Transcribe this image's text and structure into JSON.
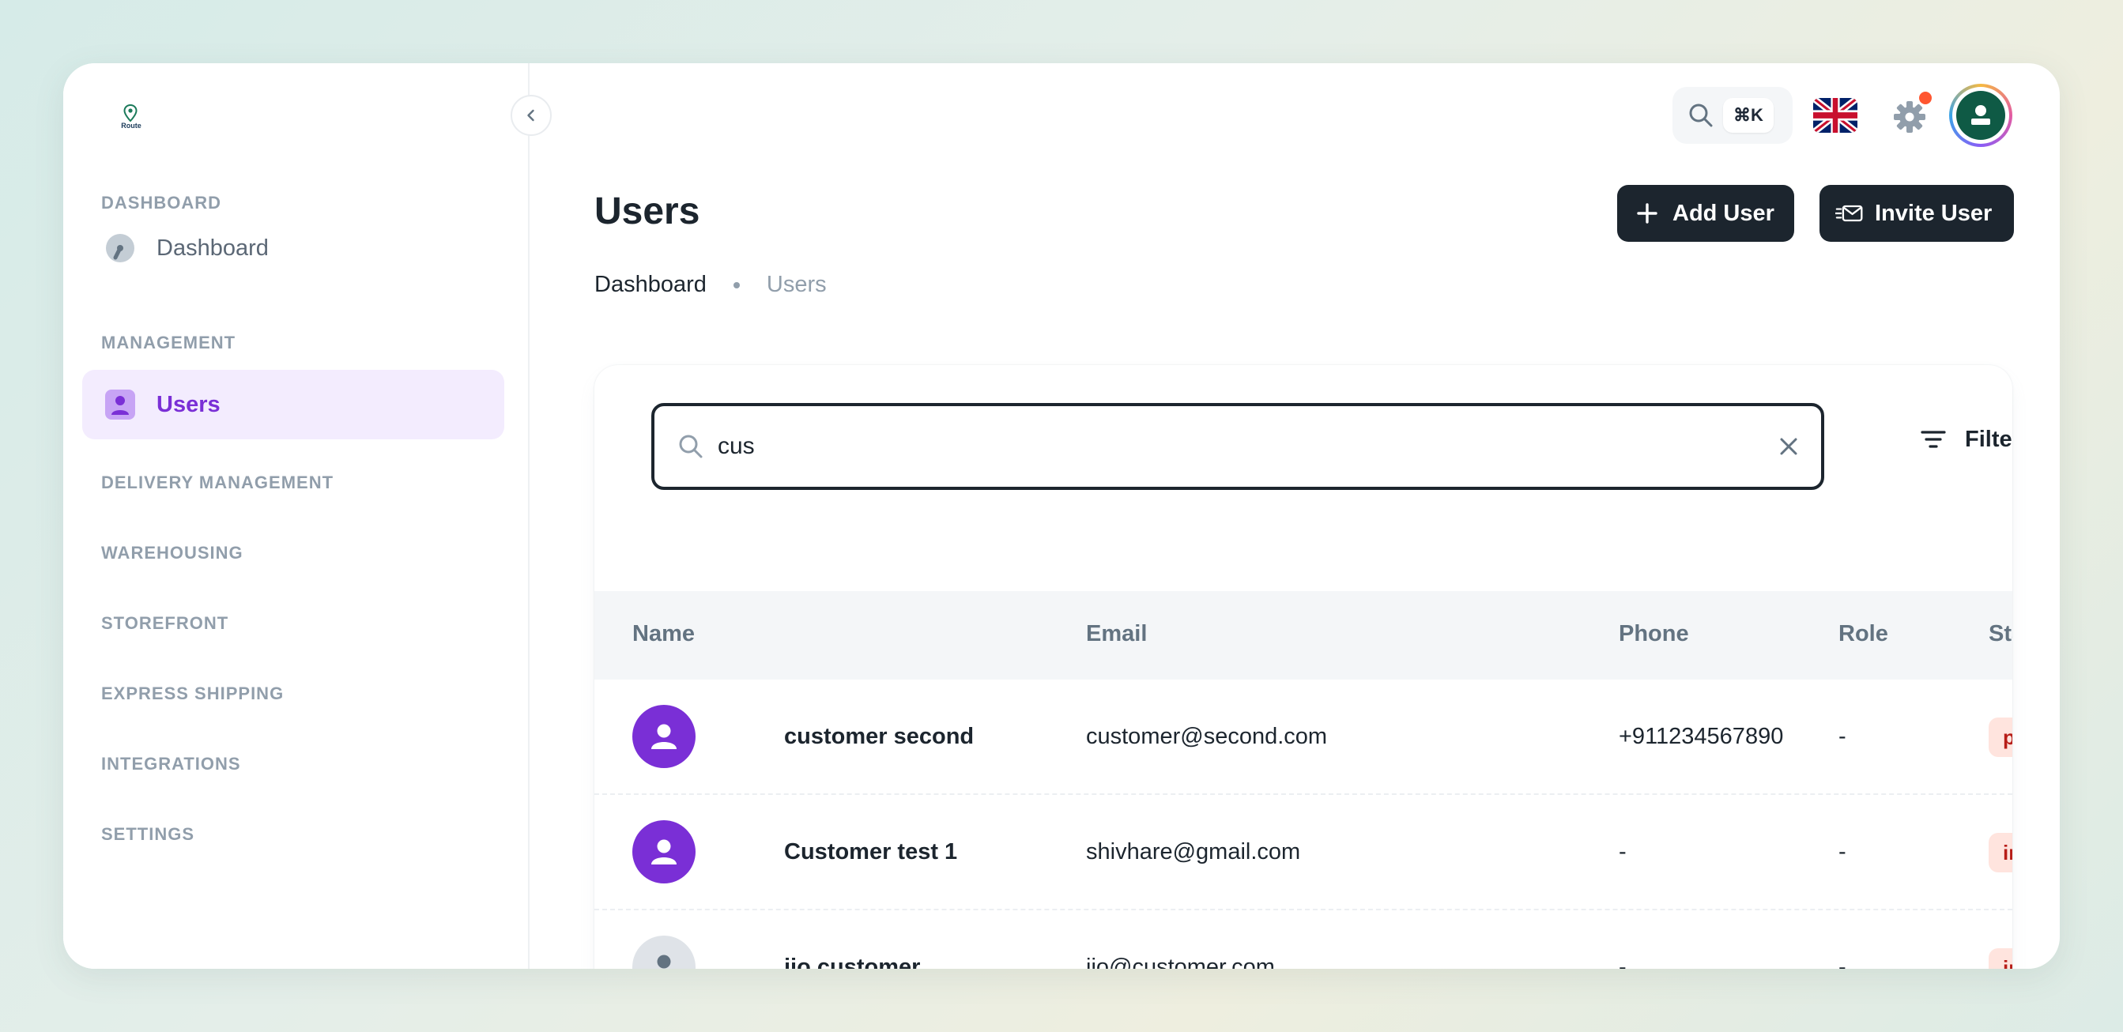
{
  "brand": {
    "logo_text": "Route",
    "accent": "#7a2fd6"
  },
  "sidebar": {
    "sections": [
      {
        "label": "DASHBOARD"
      },
      {
        "label": "MANAGEMENT"
      },
      {
        "label": "DELIVERY MANAGEMENT"
      },
      {
        "label": "WAREHOUSING"
      },
      {
        "label": "STOREFRONT"
      },
      {
        "label": "EXPRESS SHIPPING"
      },
      {
        "label": "INTEGRATIONS"
      },
      {
        "label": "SETTINGS"
      }
    ],
    "items": [
      {
        "label": "Dashboard",
        "icon": "gauge-icon"
      },
      {
        "label": "Users",
        "icon": "user-icon",
        "active": true
      }
    ]
  },
  "topbar": {
    "search_shortcut": "⌘K",
    "language": "English (UK flag)",
    "notification_color": "#ff5630"
  },
  "page": {
    "title": "Users",
    "add_user_label": "Add User",
    "invite_user_label": "Invite User",
    "breadcrumb": {
      "home": "Dashboard",
      "current": "Users"
    }
  },
  "filters": {
    "search_value": "cus",
    "filters_label": "Filters"
  },
  "table": {
    "columns": [
      "Name",
      "Email",
      "Phone",
      "Role",
      "Status"
    ],
    "rows": [
      {
        "name": "customer second",
        "email": "customer@second.com",
        "phone": "+911234567890",
        "role": "-",
        "status": "pending",
        "avatar": "purple"
      },
      {
        "name": "Customer test 1",
        "email": "shivhare@gmail.com",
        "phone": "-",
        "role": "-",
        "status": "inactive",
        "avatar": "purple"
      },
      {
        "name": "jio customer",
        "email": "jio@customer.com",
        "phone": "-",
        "role": "-",
        "status": "inactive",
        "avatar": "gray"
      }
    ]
  }
}
